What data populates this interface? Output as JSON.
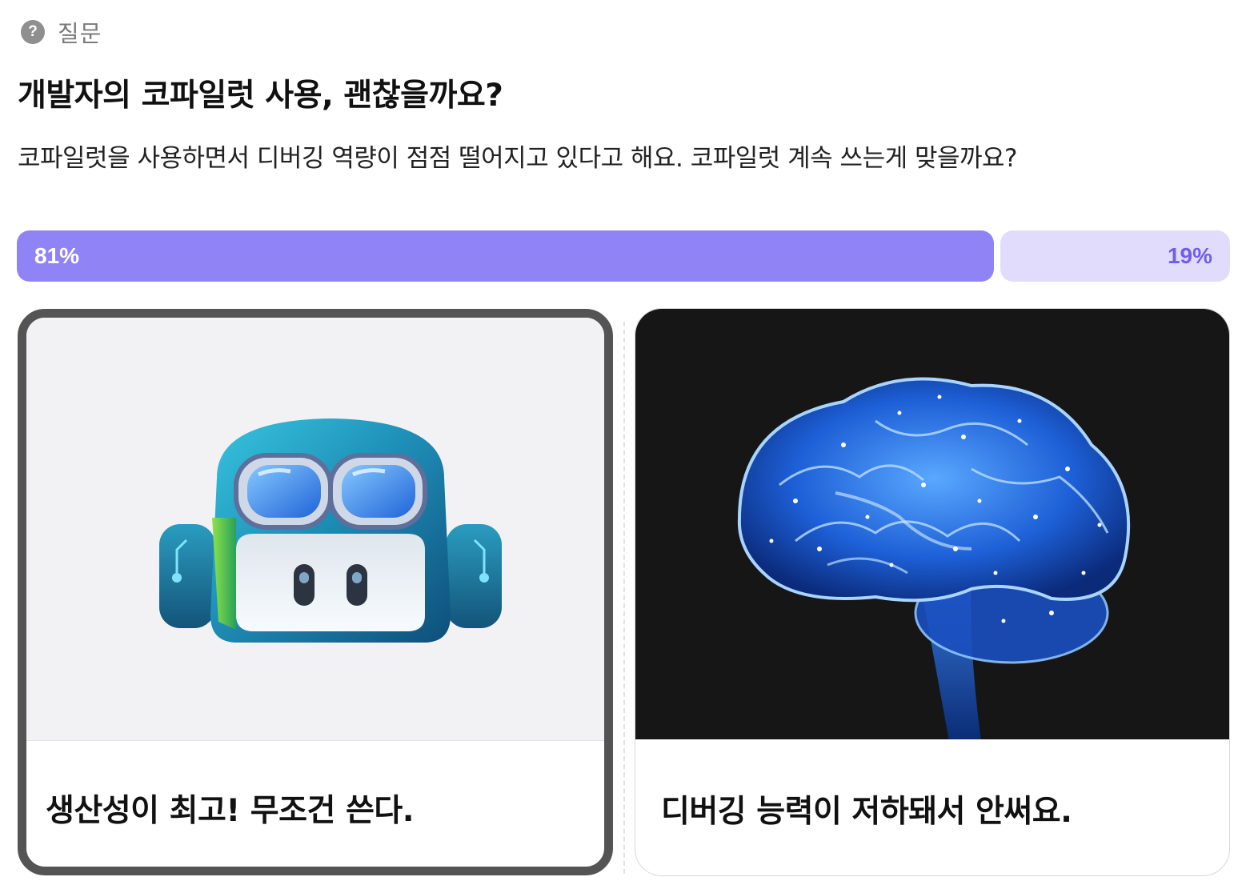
{
  "category": {
    "icon": "question-circle-icon",
    "label": "질문"
  },
  "question": {
    "title": "개발자의 코파일럿 사용, 괜찮을까요?",
    "description": "코파일럿을 사용하면서 디버깅 역량이 점점 떨어지고 있다고 해요. 코파일럿 계속 쓰는게 맞을까요?"
  },
  "results": {
    "option1_percent_label": "81%",
    "option2_percent_label": "19%",
    "option1_fraction": 0.81,
    "option2_fraction": 0.19,
    "colors": {
      "major_fill": "#9083f6",
      "minor_fill": "#e1dcfc",
      "minor_text": "#6f5fe8"
    }
  },
  "options": [
    {
      "image_icon": "copilot-robot-icon",
      "label": "생산성이 최고! 무조건 쓴다.",
      "selected": true
    },
    {
      "image_icon": "glowing-brain-icon",
      "label": "디버깅 능력이 저하돼서 안써요.",
      "selected": false
    }
  ]
}
